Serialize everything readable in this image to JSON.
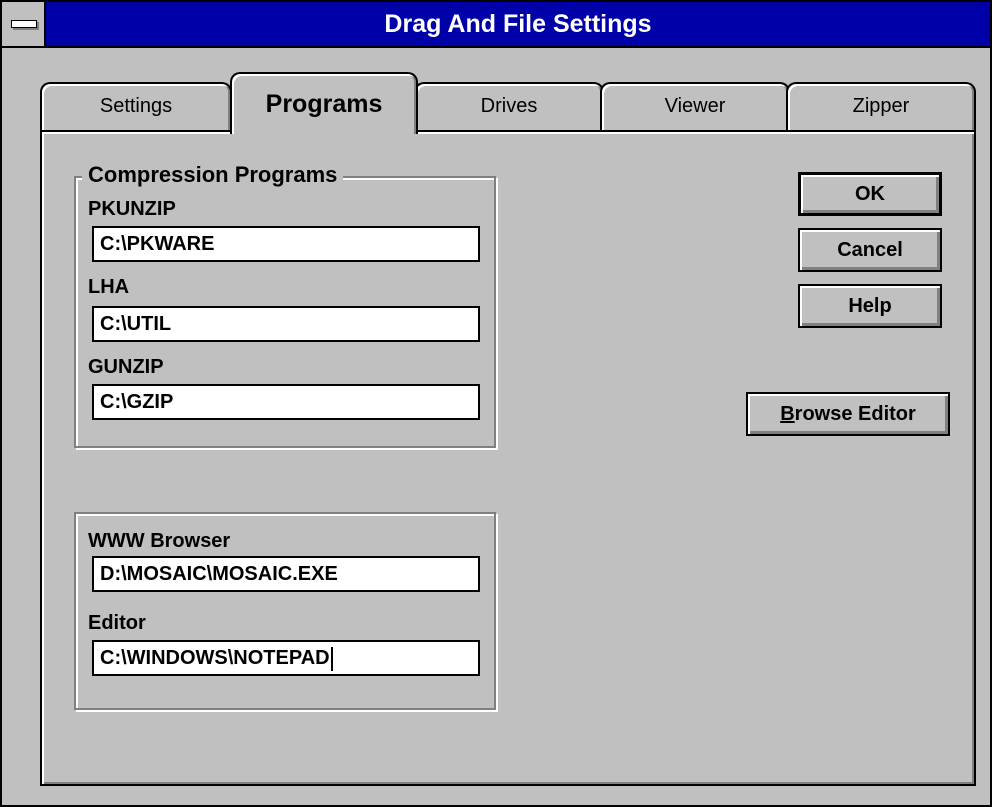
{
  "window": {
    "title": "Drag And File Settings"
  },
  "tabs": [
    {
      "label": "Settings",
      "active": false
    },
    {
      "label": "Programs",
      "active": true
    },
    {
      "label": "Drives",
      "active": false
    },
    {
      "label": "Viewer",
      "active": false
    },
    {
      "label": "Zipper",
      "active": false
    }
  ],
  "compression": {
    "caption": "Compression Programs",
    "pkunzip_label": "PKUNZIP",
    "pkunzip_value": "C:\\PKWARE",
    "lha_label": "LHA",
    "lha_value": "C:\\UTIL",
    "gunzip_label": "GUNZIP",
    "gunzip_value": "C:\\GZIP"
  },
  "apps": {
    "browser_label": "WWW Browser",
    "browser_value": "D:\\MOSAIC\\MOSAIC.EXE",
    "editor_label": "Editor",
    "editor_value": "C:\\WINDOWS\\NOTEPAD"
  },
  "buttons": {
    "ok": "OK",
    "cancel": "Cancel",
    "help": "Help",
    "browse_editor_mnemonic": "B",
    "browse_editor_rest": "rowse Editor"
  }
}
